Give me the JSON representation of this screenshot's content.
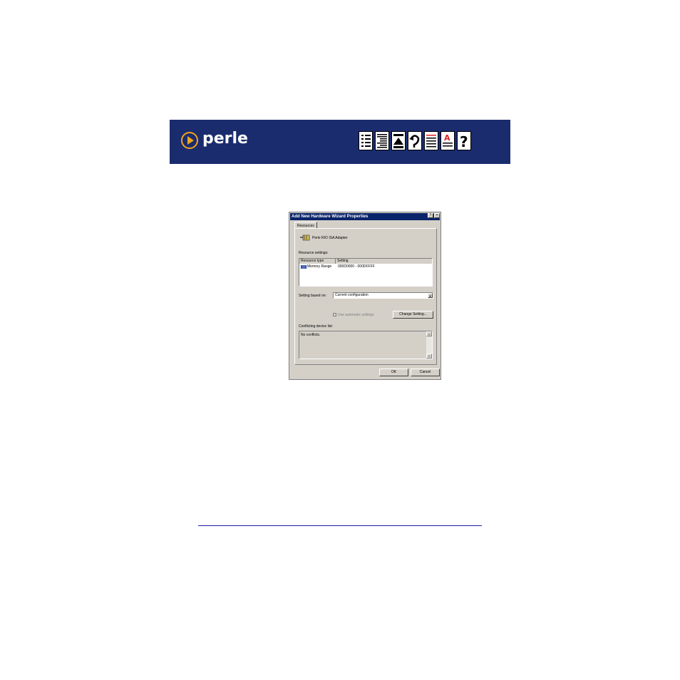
{
  "banner": {
    "brand": "perle",
    "colors": {
      "background": "#1a2c6e",
      "logo_accent": "#f2a51a"
    },
    "nav_icons": [
      "contents-icon",
      "index-icon",
      "top-icon",
      "back-icon",
      "previous-page-icon",
      "glossary-icon",
      "help-icon"
    ]
  },
  "dialog": {
    "title": "Add New Hardware Wizard Properties",
    "title_help": "?",
    "title_close": "×",
    "tab": "Resources",
    "device_name": "Perle RIO ISA Adapter",
    "resource_settings_label": "Resource settings:",
    "table": {
      "headers": [
        "Resource type",
        "Setting"
      ],
      "rows": [
        {
          "type": "Memory Range",
          "setting": "000D0000 - 000DFFFF"
        }
      ]
    },
    "setting_based_on_label": "Setting based on:",
    "setting_based_on_value": "Current configuration",
    "use_automatic_label": "Use automatic settings",
    "change_setting_label": "Change Setting...",
    "conflicting_label": "Conflicting device list:",
    "conflicts_text": "No conflicts.",
    "ok_label": "OK",
    "cancel_label": "Cancel"
  }
}
